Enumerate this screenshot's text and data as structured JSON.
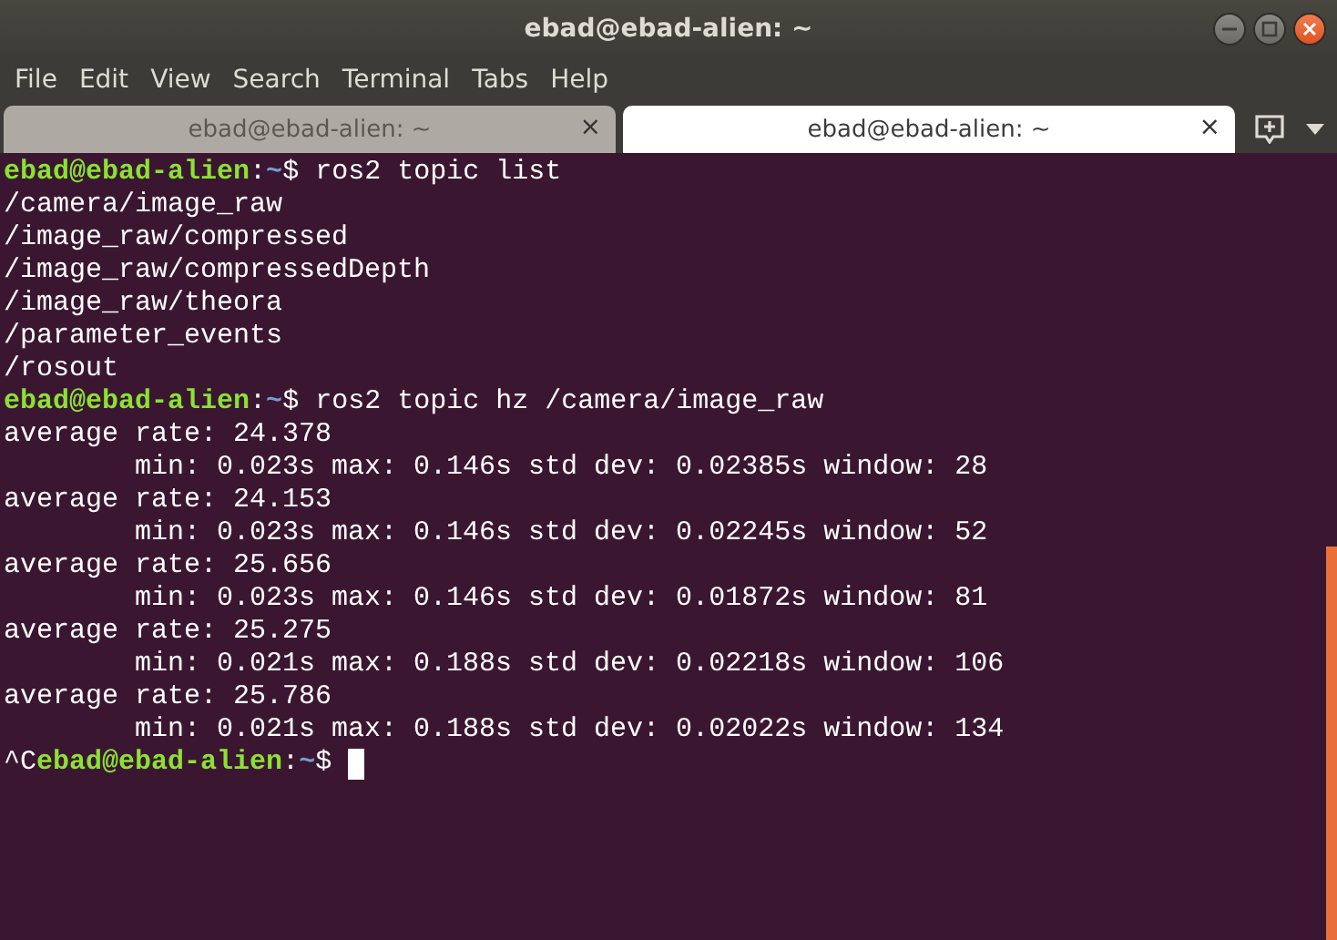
{
  "window": {
    "title": "ebad@ebad-alien: ~"
  },
  "menu": [
    "File",
    "Edit",
    "View",
    "Search",
    "Terminal",
    "Tabs",
    "Help"
  ],
  "tabs": [
    {
      "label": "ebad@ebad-alien: ~",
      "close": "×",
      "selected": false
    },
    {
      "label": "ebad@ebad-alien: ~",
      "close": "×",
      "selected": true
    }
  ],
  "terminal": {
    "lines": [
      {
        "kind": "prompt",
        "user_host": "ebad@ebad-alien",
        "sep": ":",
        "path": "~",
        "sign": "$",
        "command": "ros2 topic list"
      },
      {
        "kind": "output",
        "text": "/camera/image_raw"
      },
      {
        "kind": "output",
        "text": "/image_raw/compressed"
      },
      {
        "kind": "output",
        "text": "/image_raw/compressedDepth"
      },
      {
        "kind": "output",
        "text": "/image_raw/theora"
      },
      {
        "kind": "output",
        "text": "/parameter_events"
      },
      {
        "kind": "output",
        "text": "/rosout"
      },
      {
        "kind": "prompt",
        "user_host": "ebad@ebad-alien",
        "sep": ":",
        "path": "~",
        "sign": "$",
        "command": "ros2 topic hz /camera/image_raw"
      },
      {
        "kind": "output",
        "text": "average rate: 24.378"
      },
      {
        "kind": "output",
        "text": "        min: 0.023s max: 0.146s std dev: 0.02385s window: 28"
      },
      {
        "kind": "output",
        "text": "average rate: 24.153"
      },
      {
        "kind": "output",
        "text": "        min: 0.023s max: 0.146s std dev: 0.02245s window: 52"
      },
      {
        "kind": "output",
        "text": "average rate: 25.656"
      },
      {
        "kind": "output",
        "text": "        min: 0.023s max: 0.146s std dev: 0.01872s window: 81"
      },
      {
        "kind": "output",
        "text": "average rate: 25.275"
      },
      {
        "kind": "output",
        "text": "        min: 0.021s max: 0.188s std dev: 0.02218s window: 106"
      },
      {
        "kind": "output",
        "text": "average rate: 25.786"
      },
      {
        "kind": "output",
        "text": "        min: 0.021s max: 0.188s std dev: 0.02022s window: 134"
      },
      {
        "kind": "prompt",
        "prefix": "^C",
        "user_host": "ebad@ebad-alien",
        "sep": ":",
        "path": "~",
        "sign": "$",
        "cursor": true
      }
    ]
  }
}
